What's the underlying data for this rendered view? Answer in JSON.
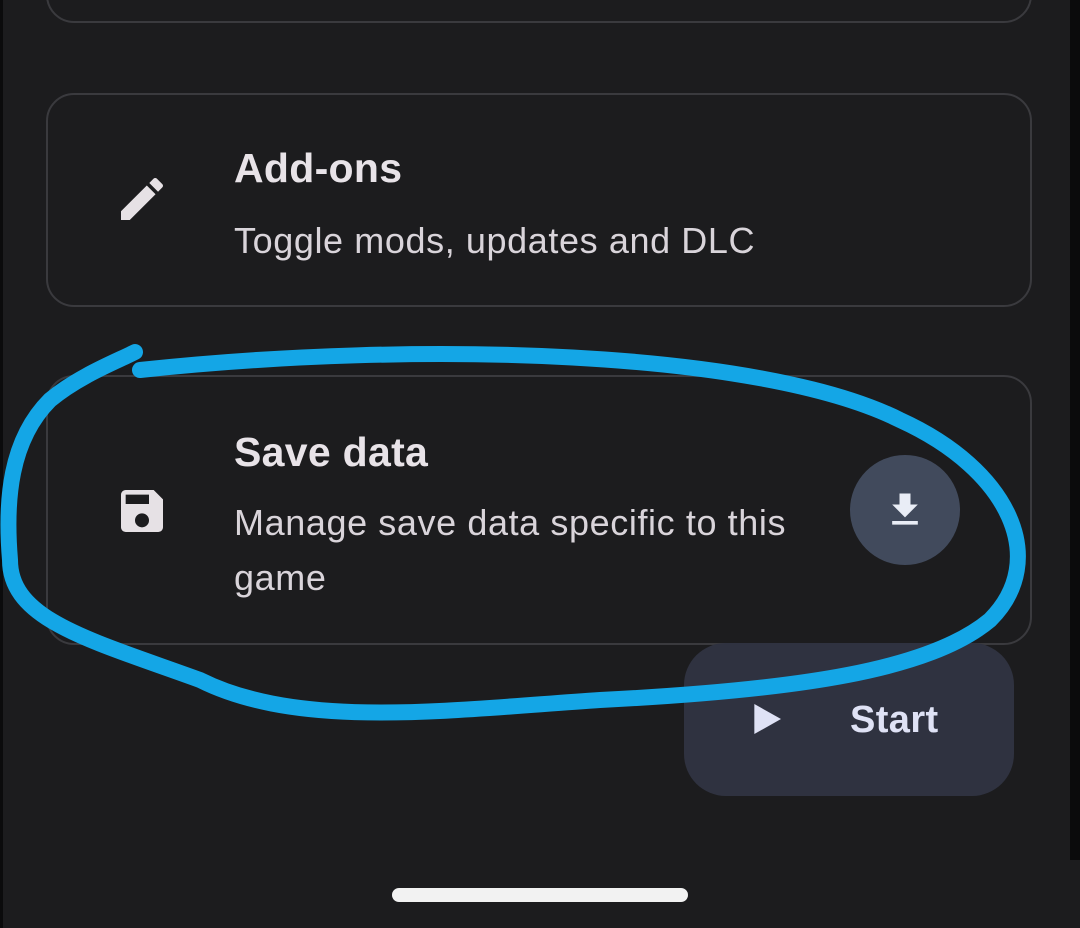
{
  "cards": {
    "addons": {
      "icon": "pencil-icon",
      "title": "Add-ons",
      "description": "Toggle mods, updates and DLC"
    },
    "save_data": {
      "icon": "floppy-disk-icon",
      "title": "Save data",
      "description": "Manage save data specific to this game",
      "action_icon": "download-icon"
    }
  },
  "fab": {
    "icon": "play-icon",
    "label": "Start"
  },
  "colors": {
    "background": "#1c1c1e",
    "card_border": "#3a3a3e",
    "fab_background": "#2f3240",
    "download_button": "#414a5c",
    "annotation_stroke": "#14a6e6"
  }
}
